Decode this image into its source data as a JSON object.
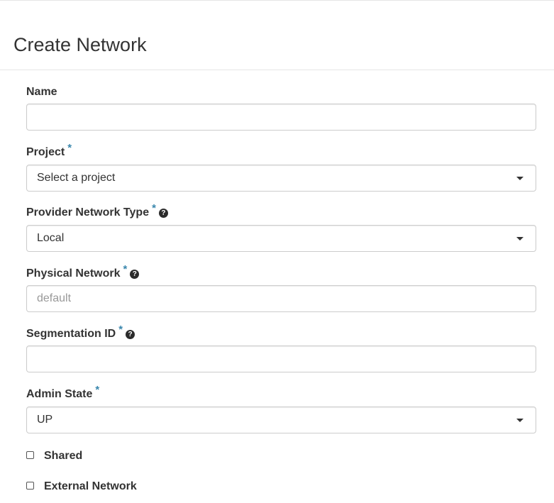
{
  "page": {
    "title": "Create Network"
  },
  "form": {
    "name": {
      "label": "Name",
      "value": "",
      "placeholder": ""
    },
    "project": {
      "label": "Project",
      "required_marker": "*",
      "selected": "Select a project"
    },
    "provider_network_type": {
      "label": "Provider Network Type",
      "required_marker": "*",
      "help_icon": "question-circle-icon",
      "help_glyph": "?",
      "selected": "Local"
    },
    "physical_network": {
      "label": "Physical Network",
      "required_marker": "*",
      "help_icon": "question-circle-icon",
      "help_glyph": "?",
      "value": "",
      "placeholder": "default"
    },
    "segmentation_id": {
      "label": "Segmentation ID",
      "required_marker": "*",
      "help_icon": "question-circle-icon",
      "help_glyph": "?",
      "value": "",
      "placeholder": ""
    },
    "admin_state": {
      "label": "Admin State",
      "required_marker": "*",
      "selected": "UP"
    },
    "shared": {
      "label": "Shared",
      "checked": false
    },
    "external_network": {
      "label": "External Network",
      "checked": false
    }
  },
  "colors": {
    "required_star": "#3a87ad",
    "text": "#333333",
    "border": "#cccccc",
    "placeholder": "#999999"
  }
}
